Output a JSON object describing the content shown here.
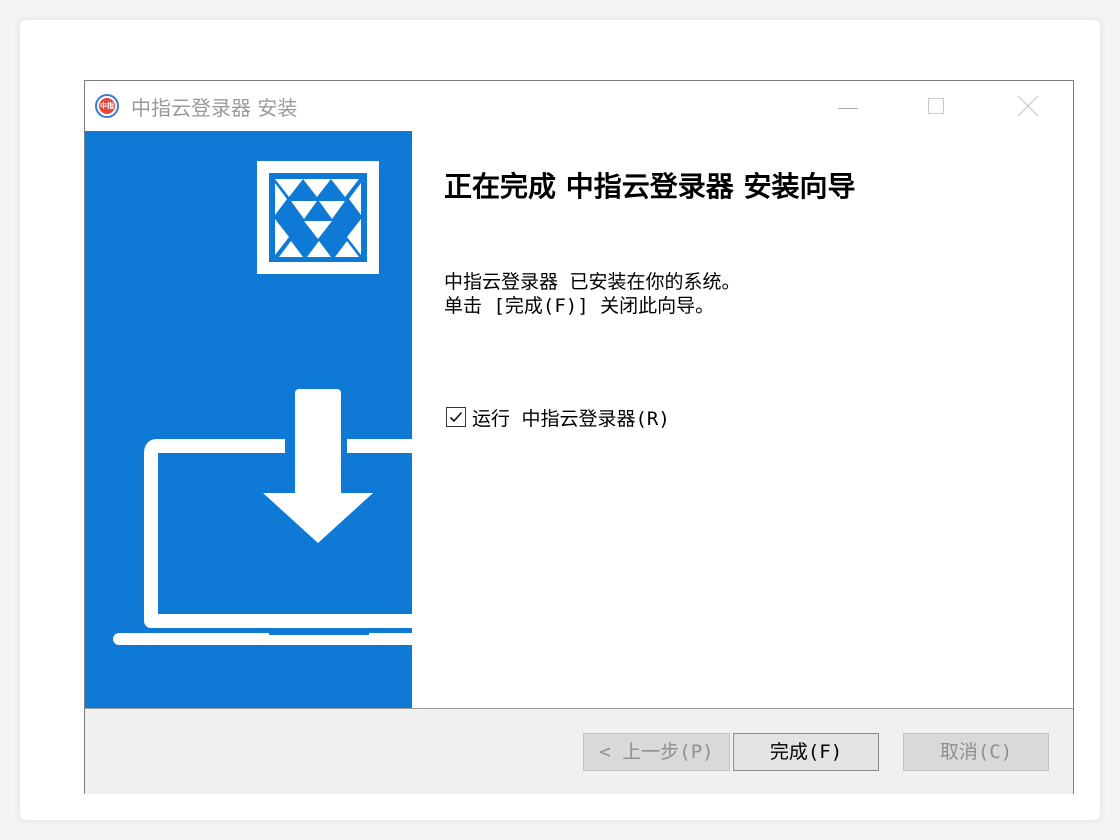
{
  "window": {
    "title": "中指云登录器 安装"
  },
  "content": {
    "heading": "正在完成 中指云登录器 安装向导",
    "message_line1": "中指云登录器 已安装在你的系统。",
    "message_line2": "单击 [完成(F)] 关闭此向导。",
    "run_checkbox": {
      "label": "运行 中指云登录器(R)",
      "checked": true
    }
  },
  "buttons": {
    "back": "< 上一步(P)",
    "finish": "完成(F)",
    "cancel": "取消(C)"
  },
  "colors": {
    "banner_blue": "#0f7ad6",
    "footer_gray": "#f0f0f0"
  },
  "icons": {
    "app": "zhongzhi-logo-icon",
    "banner_logo": "geometric-triangles-logo-icon",
    "banner_illustration": "download-to-laptop-icon"
  }
}
